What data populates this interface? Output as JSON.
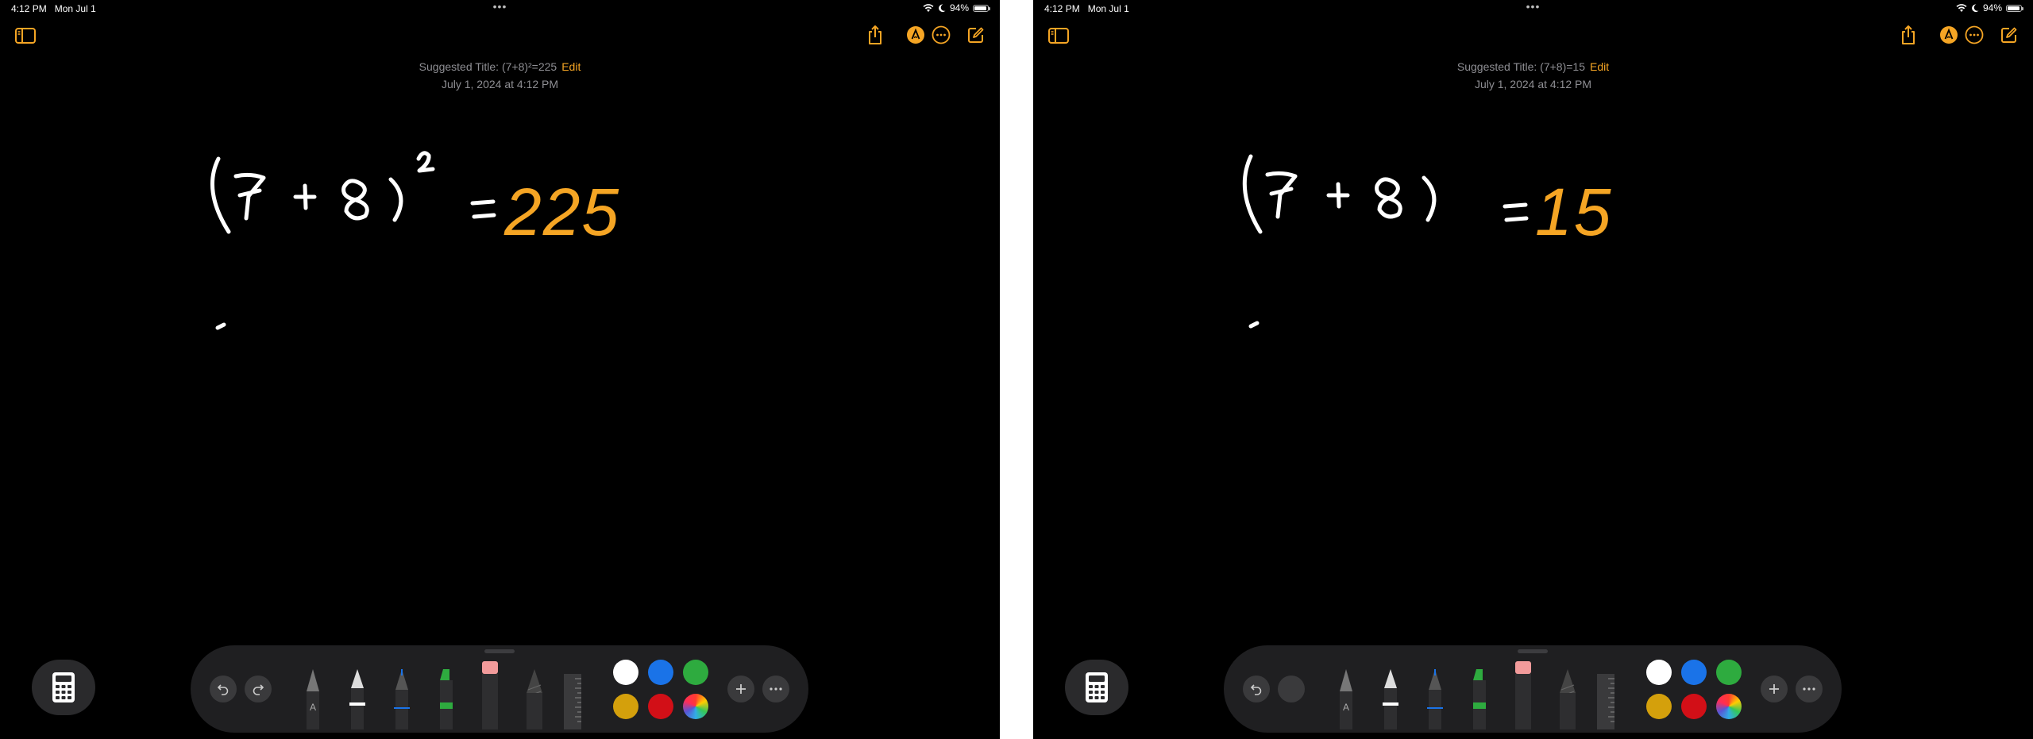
{
  "screens": [
    {
      "status": {
        "time": "4:12 PM",
        "date": "Mon Jul 1",
        "battery": "94%",
        "battery_level": 0.94
      },
      "note": {
        "title_prefix": "Suggested Title: (7+8)²=225",
        "edit_label": "Edit",
        "timestamp": "July 1, 2024 at 4:12 PM"
      },
      "result": "225",
      "redo_enabled": true
    },
    {
      "status": {
        "time": "4:12 PM",
        "date": "Mon Jul 1",
        "battery": "94%",
        "battery_level": 0.94
      },
      "note": {
        "title_prefix": "Suggested Title: (7+8)=15",
        "edit_label": "Edit",
        "timestamp": "July 1, 2024 at 4:12 PM"
      },
      "result": "15",
      "redo_enabled": false
    }
  ],
  "icons": {
    "sidebar": "sidebar-icon",
    "share": "share-icon",
    "markup": "markup-icon",
    "more": "ellipsis-circle-icon",
    "compose": "compose-icon",
    "calculator": "calculator-icon",
    "undo": "undo-icon",
    "redo": "redo-icon",
    "add": "plus-icon",
    "options": "ellipsis-icon"
  },
  "palette_colors": [
    "#ffffff",
    "#1a73e8",
    "#2eab3f",
    "#d4a00c",
    "#d20f17",
    "color-wheel"
  ],
  "accent_color": "#f5a524",
  "ink_color": "#ffffff"
}
